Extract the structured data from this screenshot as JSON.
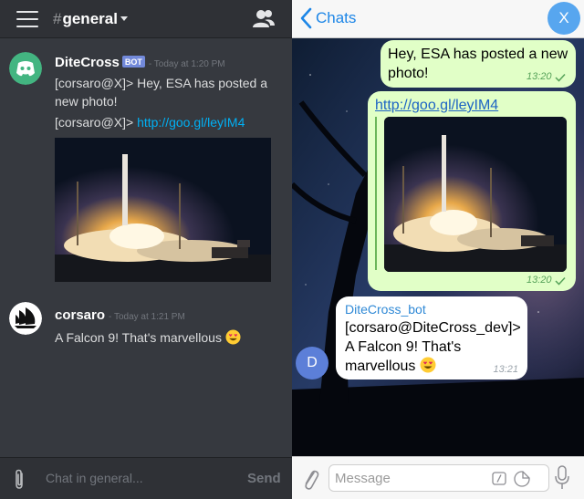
{
  "discord": {
    "channel_hash": "#",
    "channel_name": "general",
    "messages": [
      {
        "user": "DiteCross",
        "badge": "BOT",
        "time": "- Today at 1:20 PM",
        "line1": "[corsaro@X]> Hey, ESA has posted a new photo!",
        "line2_prefix": "[corsaro@X]> ",
        "line2_link": "http://goo.gl/leyIM4"
      },
      {
        "user": "corsaro",
        "time": "- Today at 1:21 PM",
        "text": "A Falcon 9! That's marvellous"
      }
    ],
    "input_placeholder": "Chat in general...",
    "send_label": "Send",
    "colors": {
      "background": "#36393f",
      "header": "#2f3136",
      "link": "#00b0f4",
      "bot_badge": "#7289da"
    }
  },
  "telegram": {
    "back_label": "Chats",
    "header_avatar": "X",
    "messages_out": [
      {
        "text": "Hey, ESA has posted a new photo!",
        "time": "13:20"
      },
      {
        "link": "http://goo.gl/leyIM4",
        "time": "13:20"
      }
    ],
    "message_in": {
      "sender": "DiteCross_bot",
      "text": "[corsaro@DiteCross_dev]> A Falcon 9! That's marvellous",
      "time": "13:21",
      "avatar_letter": "D"
    },
    "input_placeholder": "Message",
    "icons": [
      "back-chevron-icon",
      "paperclip-icon",
      "command-icon",
      "sticker-icon",
      "microphone-icon"
    ],
    "colors": {
      "accent": "#1d86e7",
      "out_bubble": "#e1ffc7",
      "in_bubble": "#ffffff"
    }
  }
}
